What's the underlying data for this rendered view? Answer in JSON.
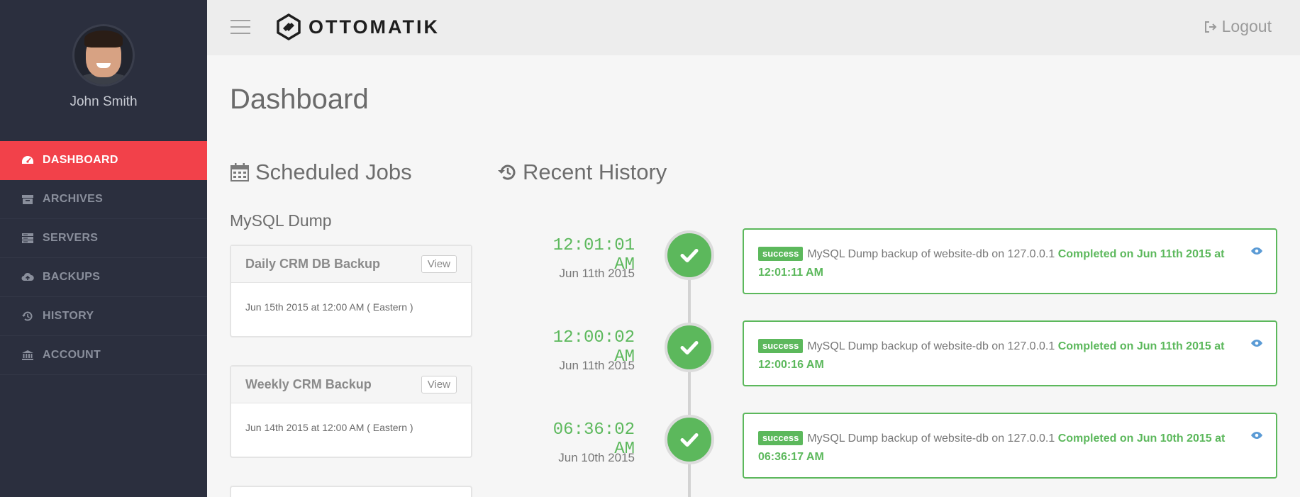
{
  "user": {
    "name": "John Smith"
  },
  "nav": [
    {
      "label": "DASHBOARD",
      "icon": "dashboard-icon"
    },
    {
      "label": "ARCHIVES",
      "icon": "archive-icon"
    },
    {
      "label": "SERVERS",
      "icon": "server-icon"
    },
    {
      "label": "BACKUPS",
      "icon": "cloud-upload-icon"
    },
    {
      "label": "HISTORY",
      "icon": "history-icon"
    },
    {
      "label": "ACCOUNT",
      "icon": "bank-icon"
    }
  ],
  "topbar": {
    "brand": "OTTOMATIK",
    "logout": "Logout"
  },
  "page": {
    "title": "Dashboard"
  },
  "scheduled": {
    "title": "Scheduled Jobs",
    "group": "MySQL Dump",
    "jobs": [
      {
        "name": "Daily CRM DB Backup",
        "view": "View",
        "schedule": "Jun 15th 2015 at 12:00 AM ( Eastern )"
      },
      {
        "name": "Weekly CRM Backup",
        "view": "View",
        "schedule": "Jun 14th 2015 at 12:00 AM ( Eastern )"
      }
    ]
  },
  "history": {
    "title": "Recent History",
    "items": [
      {
        "time": "12:01:01 AM",
        "date": "Jun 11th 2015",
        "badge": "success",
        "message": "MySQL Dump backup of website-db on 127.0.0.1",
        "completed": "Completed on Jun 11th 2015 at 12:01:11 AM"
      },
      {
        "time": "12:00:02 AM",
        "date": "Jun 11th 2015",
        "badge": "success",
        "message": "MySQL Dump backup of website-db on 127.0.0.1",
        "completed": "Completed on Jun 11th 2015 at 12:00:16 AM"
      },
      {
        "time": "06:36:02 AM",
        "date": "Jun 10th 2015",
        "badge": "success",
        "message": "MySQL Dump backup of website-db on 127.0.0.1",
        "completed": "Completed on Jun 10th 2015 at 06:36:17 AM"
      }
    ]
  },
  "colors": {
    "sidebar": "#2b2f3e",
    "active": "#f2414a",
    "success": "#5cb85c",
    "eye": "#5b9bd5"
  }
}
